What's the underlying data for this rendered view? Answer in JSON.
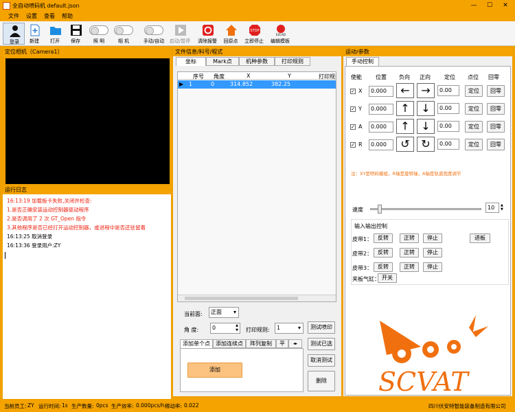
{
  "window": {
    "title": "全自动喷码机 default.json",
    "min": "—",
    "max": "☐",
    "close": "✕"
  },
  "menu": [
    "文件",
    "设置",
    "查看",
    "帮助"
  ],
  "toolbar": {
    "login": "登录",
    "new": "新建",
    "open": "打开",
    "save": "保存",
    "light": "照 明",
    "camera": "相 机",
    "manual_auto": "手动/自动",
    "start_pause": "启动/暂停",
    "clear_alarm": "清除报警",
    "home": "回原点",
    "stop": "立即停止",
    "edit_template": "编辑模板",
    "stop_icon_text": "STOP",
    "ezcad_text": "EZCAD"
  },
  "camera": {
    "title": "定位相机（Camera1）"
  },
  "log": {
    "title": "运行日志",
    "lines": [
      {
        "text": "16:13:19 加载板卡失败,关闭并检查:",
        "red": true
      },
      {
        "text": "1.是否正确安装运动控制器驱动程序",
        "red": true
      },
      {
        "text": "2.是否调用了 2 次 GT_Open 指令",
        "red": true
      },
      {
        "text": "3.其他程序是否已经打开运动控制器，或进程中是否还驻留着",
        "red": true
      },
      {
        "text": "16:13:25 取消登录",
        "red": false
      },
      {
        "text": "16:13:36 登录用户:ZY",
        "red": false
      }
    ]
  },
  "fileinfo": {
    "title": "文件信息/料号/程式",
    "tabs": [
      "坐标",
      "Mark点",
      "机种参数",
      "打印规则"
    ],
    "columns": [
      "序号",
      "角度",
      "X",
      "Y",
      "打印规则"
    ],
    "rows": [
      {
        "marker": "▶",
        "no": "1",
        "angle": "0",
        "x": "314.852",
        "y": "382.25"
      }
    ],
    "face_label": "当前面:",
    "face_value": "正面",
    "angle_label": "角  度:",
    "angle_value": "0",
    "rule_label": "打印规则:",
    "rule_value": "1",
    "btn_test_print": "测试喷印",
    "btn_test_selected": "测试已选",
    "btn_cancel_test": "取消测试",
    "btn_delete": "删除",
    "subtabs": [
      "添加单个点",
      "添加连续点",
      "阵列复制",
      "平"
    ],
    "btn_add": "添加"
  },
  "motion": {
    "title": "运动/参数",
    "tab": "手动控制",
    "headers": [
      "使能",
      "位置",
      "负向",
      "正向",
      "定位",
      "点位",
      "回零"
    ],
    "axes": [
      {
        "name": "X",
        "pos": "0.000",
        "neg": "←",
        "posdir": "→",
        "loc": "0.00"
      },
      {
        "name": "Y",
        "pos": "0.000",
        "neg": "↑",
        "posdir": "↓",
        "loc": "0.00"
      },
      {
        "name": "A",
        "pos": "0.000",
        "neg": "↑",
        "posdir": "↓",
        "loc": "0.00"
      },
      {
        "name": "R",
        "pos": "0.000",
        "neg": "↺",
        "posdir": "↻",
        "loc": "0.00"
      }
    ],
    "btn_locate": "定位",
    "btn_home": "回零",
    "note": "注：XY是喷码模组，R轴是旋转轴，A轴是轨道宽度调节",
    "speed_label": "速度",
    "speed_value": "10",
    "speed_fraction": 0.08,
    "io_title": "输入输出控制",
    "belts": [
      {
        "label": "皮带1：",
        "b1": "反转",
        "b2": "正转",
        "b3": "停止"
      },
      {
        "label": "皮带2：",
        "b1": "反转",
        "b2": "正转",
        "b3": "停止"
      },
      {
        "label": "皮带3：",
        "b1": "反转",
        "b2": "正转",
        "b3": "停止"
      }
    ],
    "btn_feed": "进板",
    "clamp_label": "夹板气缸：",
    "btn_switch": "开关",
    "logo_text": "SCVAT",
    "logo_color": "#f07010"
  },
  "status": {
    "operator_label": "当前员工:",
    "operator": "ZY",
    "runtime_label": "运行时间:",
    "runtime": "1s",
    "count_label": "生产数量:",
    "count": "0pcs",
    "eff_label": "生产效率:",
    "eff": "0.000pcs/h",
    "rate_label": "稼动率:",
    "rate": "0.022",
    "company": "四川伏安特智能装备制造有限公司"
  }
}
